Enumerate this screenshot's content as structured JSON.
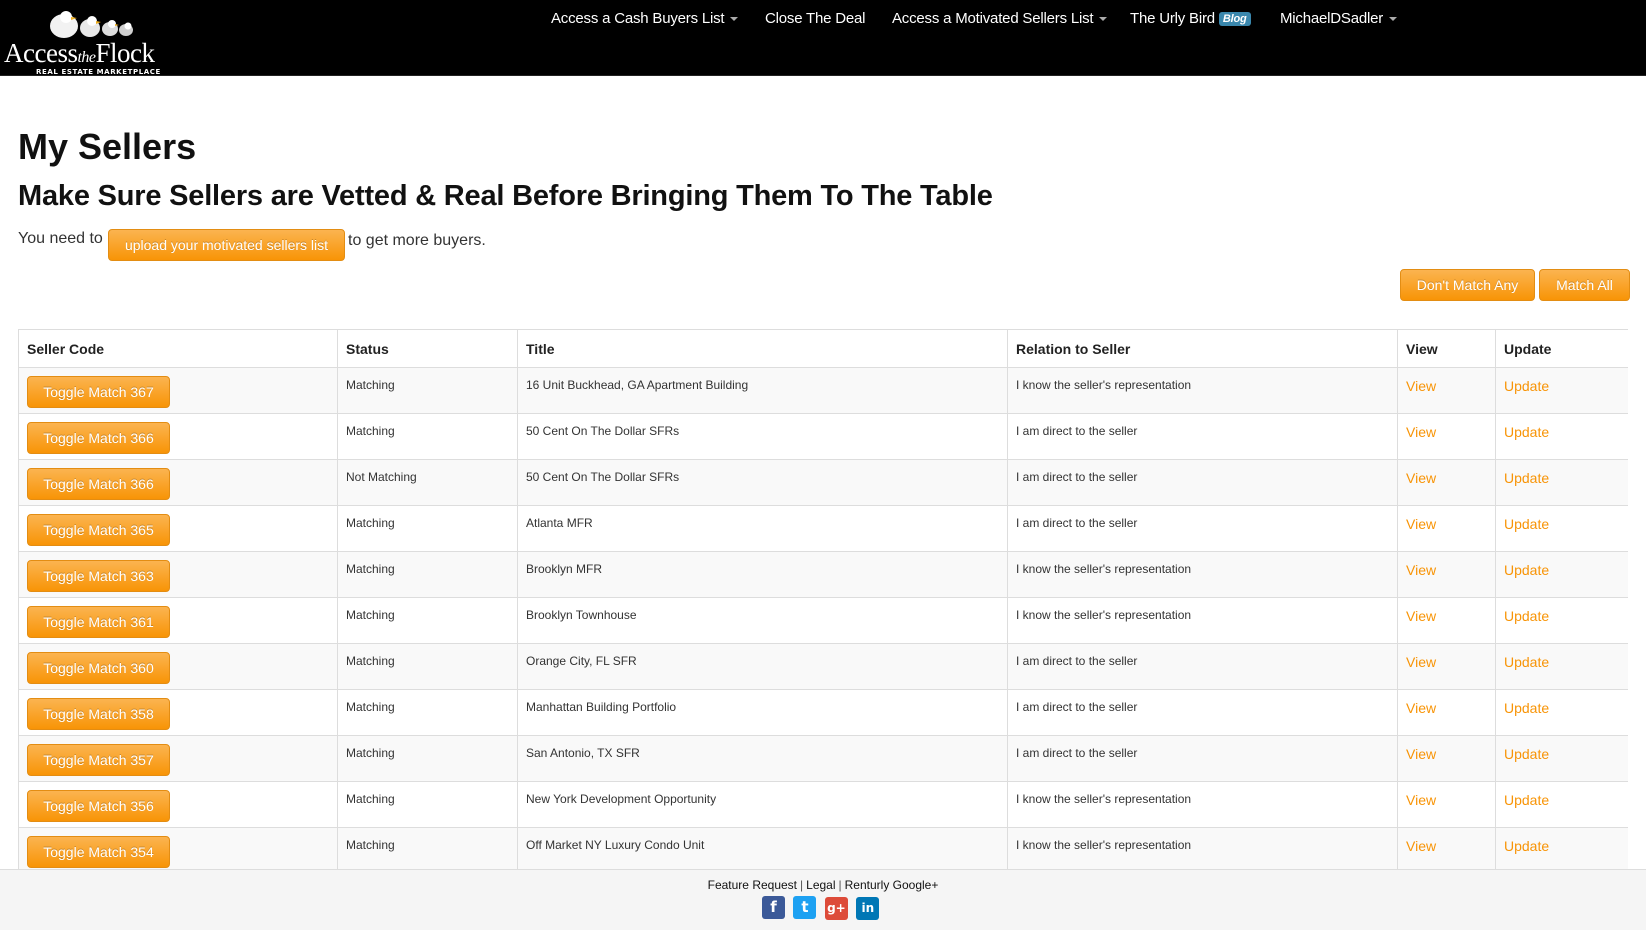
{
  "brand": {
    "name_prefix": "Access",
    "name_mid": "the",
    "name_suffix": "Flock",
    "tagline": "REAL ESTATE MARKETPLACE"
  },
  "nav": {
    "items": [
      {
        "label": "Access a Cash Buyers List",
        "dropdown": true
      },
      {
        "label": "Close The Deal",
        "dropdown": false
      },
      {
        "label": "Access a Motivated Sellers List",
        "dropdown": true
      },
      {
        "label": "The Urly Bird",
        "badge": "Blog",
        "dropdown": false
      },
      {
        "label": "MichaelDSadler",
        "dropdown": true
      }
    ]
  },
  "page": {
    "title": "My Sellers",
    "subtitle": "Make Sure Sellers are Vetted & Real Before Bringing Them To The Table",
    "notice_before": "You need to",
    "upload_label": "upload your motivated sellers list",
    "notice_after": "to get more buyers.",
    "dont_match_label": "Don't Match Any",
    "match_all_label": "Match All"
  },
  "table": {
    "columns": [
      "Seller Code",
      "Status",
      "Title",
      "Relation to Seller",
      "View",
      "Update"
    ],
    "rows": [
      {
        "toggle": "Toggle Match 367",
        "status": "Matching",
        "title": "16 Unit Buckhead, GA Apartment Building",
        "relation": "I know the seller's representation",
        "view": "View",
        "update": "Update"
      },
      {
        "toggle": "Toggle Match 366",
        "status": "Matching",
        "title": "50 Cent On The Dollar SFRs",
        "relation": "I am direct to the seller",
        "view": "View",
        "update": "Update"
      },
      {
        "toggle": "Toggle Match 366",
        "status": "Not Matching",
        "title": "50 Cent On The Dollar SFRs",
        "relation": "I am direct to the seller",
        "view": "View",
        "update": "Update"
      },
      {
        "toggle": "Toggle Match 365",
        "status": "Matching",
        "title": "Atlanta MFR",
        "relation": "I am direct to the seller",
        "view": "View",
        "update": "Update"
      },
      {
        "toggle": "Toggle Match 363",
        "status": "Matching",
        "title": "Brooklyn MFR",
        "relation": "I know the seller's representation",
        "view": "View",
        "update": "Update"
      },
      {
        "toggle": "Toggle Match 361",
        "status": "Matching",
        "title": "Brooklyn Townhouse",
        "relation": "I know the seller's representation",
        "view": "View",
        "update": "Update"
      },
      {
        "toggle": "Toggle Match 360",
        "status": "Matching",
        "title": "Orange City, FL SFR",
        "relation": "I am direct to the seller",
        "view": "View",
        "update": "Update"
      },
      {
        "toggle": "Toggle Match 358",
        "status": "Matching",
        "title": "Manhattan Building Portfolio",
        "relation": "I am direct to the seller",
        "view": "View",
        "update": "Update"
      },
      {
        "toggle": "Toggle Match 357",
        "status": "Matching",
        "title": "San Antonio, TX SFR",
        "relation": "I am direct to the seller",
        "view": "View",
        "update": "Update"
      },
      {
        "toggle": "Toggle Match 356",
        "status": "Matching",
        "title": "New York Development Opportunity",
        "relation": "I know the seller's representation",
        "view": "View",
        "update": "Update"
      },
      {
        "toggle": "Toggle Match 354",
        "status": "Matching",
        "title": "Off Market NY Luxury Condo Unit",
        "relation": "I know the seller's representation",
        "view": "View",
        "update": "Update"
      }
    ]
  },
  "footer": {
    "links": [
      "Feature Request",
      "Legal",
      "Renturly Google+"
    ],
    "social": [
      {
        "icon": "facebook-icon",
        "glyph": "f",
        "color": "#3b5998"
      },
      {
        "icon": "twitter-icon",
        "glyph": "t",
        "color": "#1da1f2"
      },
      {
        "icon": "google-plus-icon",
        "glyph": "g+",
        "color": "#dd4b39"
      },
      {
        "icon": "linkedin-icon",
        "glyph": "in",
        "color": "#0077b5"
      }
    ]
  },
  "colors": {
    "accent": "#f89406",
    "navbar": "#000000",
    "badge": "#3a87ad"
  }
}
